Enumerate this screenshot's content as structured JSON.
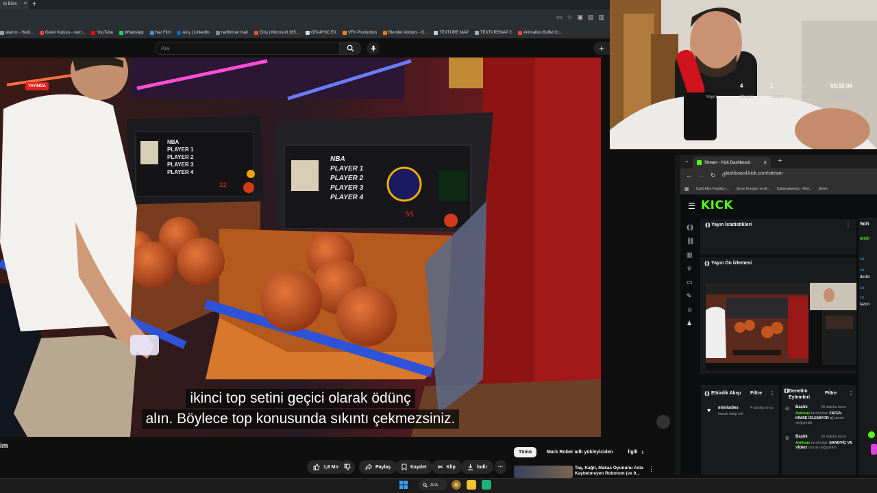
{
  "youtube_browser": {
    "tab_title": "ini Bilim",
    "bookmarks": [
      "alarnız - Hedi...",
      "Gelen Kutusu - nurn...",
      "YouTube",
      "WhatsApp",
      "Nar Film",
      "Akış | LinkedIn",
      "narfilmnet mail",
      "Giriş | Microsoft 365...",
      "GRAPHIC EX",
      "VFX Production",
      "Blender Addons - G...",
      "TEXTURE MAP",
      "TEXTUREMAP 2",
      "Animation Buffet Cr..."
    ],
    "bookmark_colors": [
      "#9aa0a6",
      "#ea4335",
      "#ff0000",
      "#25d366",
      "#4a90e2",
      "#0a66c2",
      "#888888",
      "#f25022",
      "#dddddd",
      "#f08a24",
      "#e87d0d",
      "#cccccc",
      "#aaaaaa",
      "#e44"
    ]
  },
  "youtube": {
    "search_placeholder": "Ara",
    "subtitle_line1": "ikinci top setini geçici olarak ödünç",
    "subtitle_line2": "alın. Böylece top konusunda sıkıntı çekmezsiniz.",
    "video_title_fragment": "im",
    "actions": {
      "likes": "1,6 Mn",
      "share": "Paylaş",
      "save": "Kaydet",
      "clip": "Klip",
      "download": "İndir"
    },
    "chips": [
      "Tümü",
      "Mark Rober adlı yükleyiciden",
      "İlgili"
    ],
    "recommended_title": "Taş, Kağıt, Makas Oyununu Asla Kaybetmeyen Robotum (ve 9..."
  },
  "video_scene": {
    "cabinet_left_labels": [
      "NBA",
      "PLAYER 1",
      "PLAYER 2",
      "PLAYER 3",
      "PLAYER 4"
    ],
    "cabinet_left_score": "22",
    "cabinet_right_labels": [
      "NBA",
      "PLAYER 1",
      "PLAYER 2",
      "PLAYER 3",
      "PLAYER 4"
    ],
    "cabinet_right_score": "55"
  },
  "kick_browser": {
    "tab_title": "Stream - Kick Dashboard",
    "url": "dashboard.kick.com/stream",
    "bookmarks": [
      "Canlı Altın Fiyatları |...",
      "Sınav Konuları ve Al...",
      "Çalışmalarımız - Hed...",
      "Gelen"
    ],
    "logo": "KICK"
  },
  "kick": {
    "stats_title": "Yayın İstatistikleri",
    "live_badge": "YAYINDA",
    "stats": [
      {
        "value": "",
        "label": "Yayın"
      },
      {
        "value": "4",
        "label": "İzleyici"
      },
      {
        "value": "1",
        "label": "Takipçi"
      },
      {
        "value": "-",
        "label": "Abone"
      },
      {
        "value": "00:10:06",
        "label": "Yayında"
      }
    ],
    "preview_title": "Yayın Ön İzlemesi",
    "activity_title": "Etkinlik Akışı",
    "activity_filter": "Filtre",
    "activity_item": {
      "user": "minilodies",
      "time": "4 dakika önce",
      "text": "kanalı takip etti"
    },
    "mod_title": "Denetim Eylemleri",
    "mod_filter": "Filtre",
    "mod_items": [
      {
        "title": "Başlık",
        "time": "28 dakika önce",
        "user": "Asilious",
        "pre": "tarafından",
        "bold": "ZATEN KİMSE İZLEMİYOR :(",
        "post": "olarak değiştirildi"
      },
      {
        "title": "Başlık",
        "time": "30 dakika önce",
        "user": "Asilious",
        "pre": "tarafından",
        "bold": "SANDVİÇ VE VİDEO",
        "post": "olarak değiştirildi"
      }
    ],
    "chat_title": "Soh",
    "chat_lines": [
      "minil",
      "co",
      "co",
      "dedin",
      "co",
      "co",
      "lazım"
    ]
  },
  "taskbar": {
    "search": "Ara"
  }
}
